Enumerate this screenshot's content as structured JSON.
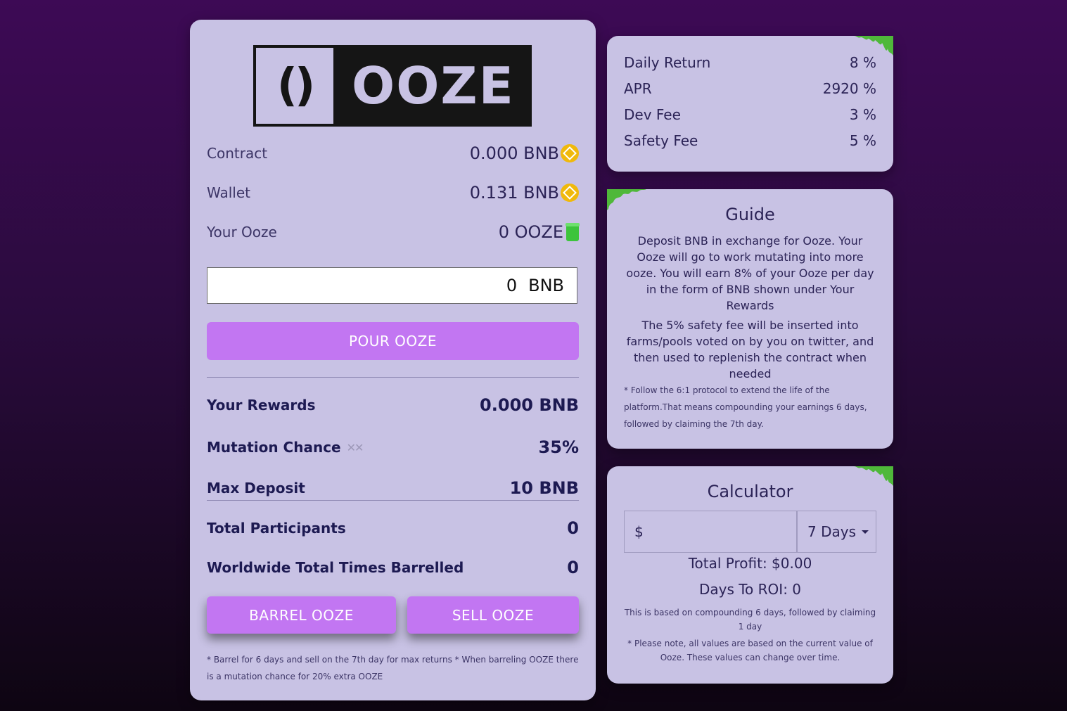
{
  "logo": {
    "text": "OOZE",
    "parens": "()"
  },
  "balances": {
    "contract_label": "Contract",
    "contract_value": "0.000 BNB",
    "wallet_label": "Wallet",
    "wallet_value": "0.131 BNB",
    "ooze_label": "Your Ooze",
    "ooze_value": "0 OOZE"
  },
  "deposit": {
    "value": "0",
    "unit": "BNB",
    "pour_label": "POUR OOZE"
  },
  "rewards": {
    "rewards_label": "Your Rewards",
    "rewards_value": "0.000 BNB",
    "mutation_label": "Mutation Chance",
    "mutation_value": "35%",
    "max_label": "Max Deposit",
    "max_value": "10 BNB",
    "participants_label": "Total Participants",
    "participants_value": "0",
    "barrelled_label": "Worldwide Total Times Barrelled",
    "barrelled_value": "0"
  },
  "actions": {
    "barrel_label": "BARREL OOZE",
    "sell_label": "SELL OOZE"
  },
  "footnote": "* Barrel for 6 days and sell on the 7th day for max returns * When barreling OOZE there is a mutation chance for 20% extra OOZE",
  "stats": [
    {
      "label": "Daily Return",
      "value": "8 %"
    },
    {
      "label": "APR",
      "value": "2920 %"
    },
    {
      "label": "Dev Fee",
      "value": "3 %"
    },
    {
      "label": "Safety Fee",
      "value": "5 %"
    }
  ],
  "guide": {
    "title": "Guide",
    "p1": "Deposit BNB in exchange for Ooze. Your Ooze will go to work mutating into more ooze. You will earn 8% of your Ooze per day in the form of BNB shown under Your Rewards",
    "p2": "The 5% safety fee will be inserted into farms/pools voted on by you on twitter, and then used to replenish the contract when needed",
    "note": "* Follow the 6:1 protocol to extend the life of the platform.That means compounding your earnings 6 days, followed by claiming the 7th day."
  },
  "calculator": {
    "title": "Calculator",
    "usd_prefix": "$",
    "days_selected": "7 Days",
    "total_profit": "Total Profit: $0.00",
    "days_to_roi": "Days To ROI: 0",
    "note1": "This is based on compounding 6 days, followed by claiming 1 day",
    "note2": "* Please note, all values are based on the current value of Ooze. These values can change over time."
  },
  "colors": {
    "button": "#c276f2",
    "card": "#c8c2e4",
    "bnb": "#f0b90b",
    "ooze": "#3cc43c"
  }
}
